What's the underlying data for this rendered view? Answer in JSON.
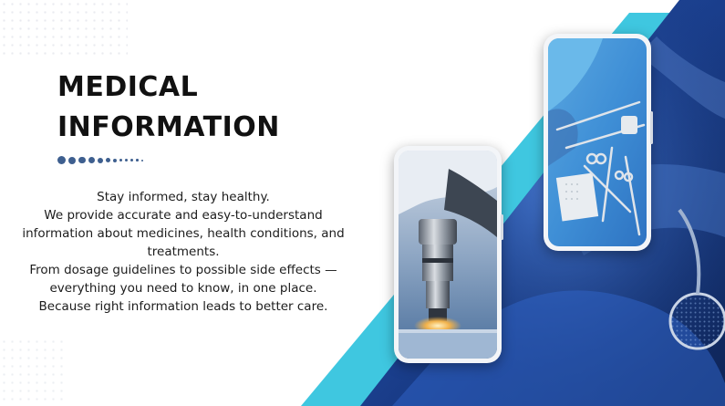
{
  "title": {
    "line1": "MEDICAL",
    "line2": "INFORMATION"
  },
  "description": [
    "Stay informed, stay healthy.",
    "We provide accurate and easy-to-understand information about medicines, health conditions, and treatments.",
    "From dosage guidelines to possible side effects — everything you need to know, in one place.",
    "Because right information leads to better care."
  ],
  "colors": {
    "accent_cyan": "#3fc7e0",
    "navy": "#1b3d86",
    "dot": "#3e5f8f"
  },
  "images": {
    "phone_left": "microscope-objective-photo",
    "phone_right": "surgical-instruments-tray-photo",
    "background": "surgeon-glove-photo"
  }
}
